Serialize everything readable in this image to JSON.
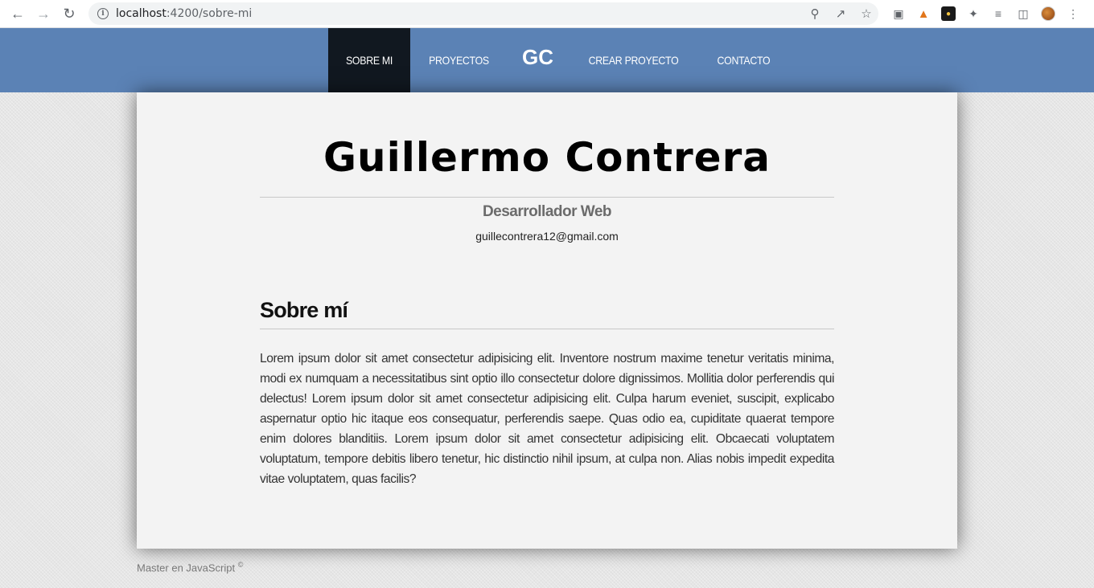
{
  "browser": {
    "url_host": "localhost",
    "url_path": ":4200/sobre-mi"
  },
  "nav": {
    "items": [
      {
        "label": "SOBRE MI",
        "active": true
      },
      {
        "label": "PROYECTOS",
        "active": false
      },
      {
        "label": "GC",
        "logo": true
      },
      {
        "label": "CREAR PROYECTO",
        "active": false
      },
      {
        "label": "CONTACTO",
        "active": false
      }
    ]
  },
  "header": {
    "name": "Guillermo Contrera",
    "role": "Desarrollador Web",
    "email": "guillecontrera12@gmail.com"
  },
  "about": {
    "title": "Sobre mí",
    "text": "Lorem ipsum dolor sit amet consectetur adipisicing elit. Inventore nostrum maxime tenetur veritatis minima, modi ex numquam a necessitatibus sint optio illo consectetur dolore dignissimos. Mollitia dolor perferendis qui delectus! Lorem ipsum dolor sit amet consectetur adipisicing elit. Culpa harum eveniet, suscipit, explicabo aspernatur optio hic itaque eos consequatur, perferendis saepe. Quas odio ea, cupiditate quaerat tempore enim dolores blanditiis. Lorem ipsum dolor sit amet consectetur adipisicing elit. Obcaecati voluptatem voluptatum, tempore debitis libero tenetur, hic distinctio nihil ipsum, at culpa non. Alias nobis impedit expedita vitae voluptatem, quas facilis?"
  },
  "footer": {
    "text": "Master en JavaScript",
    "symbol": "©"
  },
  "colors": {
    "topbar": "#5b82b5",
    "active_nav": "#111820",
    "card": "#f3f3f3"
  }
}
